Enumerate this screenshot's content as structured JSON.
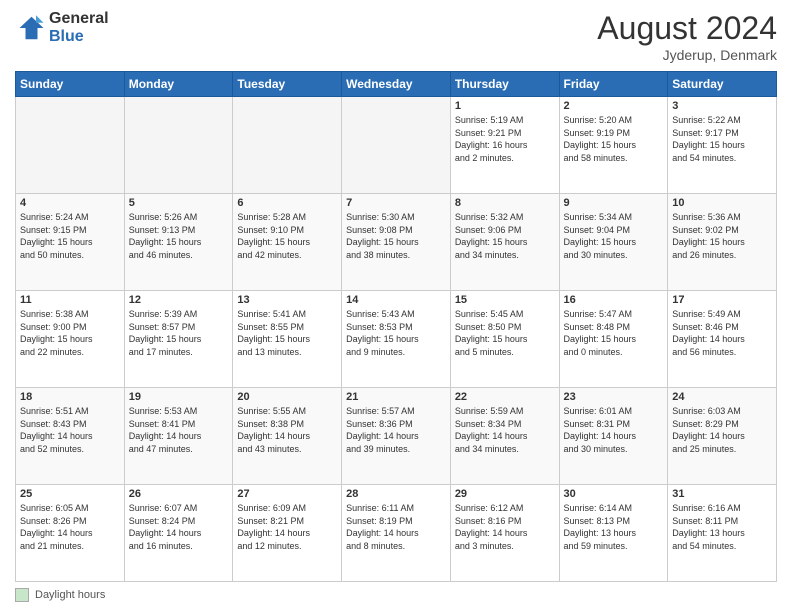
{
  "header": {
    "logo_line1": "General",
    "logo_line2": "Blue",
    "month_title": "August 2024",
    "location": "Jyderup, Denmark"
  },
  "footer": {
    "label": "Daylight hours"
  },
  "days_of_week": [
    "Sunday",
    "Monday",
    "Tuesday",
    "Wednesday",
    "Thursday",
    "Friday",
    "Saturday"
  ],
  "weeks": [
    [
      {
        "day": "",
        "info": ""
      },
      {
        "day": "",
        "info": ""
      },
      {
        "day": "",
        "info": ""
      },
      {
        "day": "",
        "info": ""
      },
      {
        "day": "1",
        "info": "Sunrise: 5:19 AM\nSunset: 9:21 PM\nDaylight: 16 hours\nand 2 minutes."
      },
      {
        "day": "2",
        "info": "Sunrise: 5:20 AM\nSunset: 9:19 PM\nDaylight: 15 hours\nand 58 minutes."
      },
      {
        "day": "3",
        "info": "Sunrise: 5:22 AM\nSunset: 9:17 PM\nDaylight: 15 hours\nand 54 minutes."
      }
    ],
    [
      {
        "day": "4",
        "info": "Sunrise: 5:24 AM\nSunset: 9:15 PM\nDaylight: 15 hours\nand 50 minutes."
      },
      {
        "day": "5",
        "info": "Sunrise: 5:26 AM\nSunset: 9:13 PM\nDaylight: 15 hours\nand 46 minutes."
      },
      {
        "day": "6",
        "info": "Sunrise: 5:28 AM\nSunset: 9:10 PM\nDaylight: 15 hours\nand 42 minutes."
      },
      {
        "day": "7",
        "info": "Sunrise: 5:30 AM\nSunset: 9:08 PM\nDaylight: 15 hours\nand 38 minutes."
      },
      {
        "day": "8",
        "info": "Sunrise: 5:32 AM\nSunset: 9:06 PM\nDaylight: 15 hours\nand 34 minutes."
      },
      {
        "day": "9",
        "info": "Sunrise: 5:34 AM\nSunset: 9:04 PM\nDaylight: 15 hours\nand 30 minutes."
      },
      {
        "day": "10",
        "info": "Sunrise: 5:36 AM\nSunset: 9:02 PM\nDaylight: 15 hours\nand 26 minutes."
      }
    ],
    [
      {
        "day": "11",
        "info": "Sunrise: 5:38 AM\nSunset: 9:00 PM\nDaylight: 15 hours\nand 22 minutes."
      },
      {
        "day": "12",
        "info": "Sunrise: 5:39 AM\nSunset: 8:57 PM\nDaylight: 15 hours\nand 17 minutes."
      },
      {
        "day": "13",
        "info": "Sunrise: 5:41 AM\nSunset: 8:55 PM\nDaylight: 15 hours\nand 13 minutes."
      },
      {
        "day": "14",
        "info": "Sunrise: 5:43 AM\nSunset: 8:53 PM\nDaylight: 15 hours\nand 9 minutes."
      },
      {
        "day": "15",
        "info": "Sunrise: 5:45 AM\nSunset: 8:50 PM\nDaylight: 15 hours\nand 5 minutes."
      },
      {
        "day": "16",
        "info": "Sunrise: 5:47 AM\nSunset: 8:48 PM\nDaylight: 15 hours\nand 0 minutes."
      },
      {
        "day": "17",
        "info": "Sunrise: 5:49 AM\nSunset: 8:46 PM\nDaylight: 14 hours\nand 56 minutes."
      }
    ],
    [
      {
        "day": "18",
        "info": "Sunrise: 5:51 AM\nSunset: 8:43 PM\nDaylight: 14 hours\nand 52 minutes."
      },
      {
        "day": "19",
        "info": "Sunrise: 5:53 AM\nSunset: 8:41 PM\nDaylight: 14 hours\nand 47 minutes."
      },
      {
        "day": "20",
        "info": "Sunrise: 5:55 AM\nSunset: 8:38 PM\nDaylight: 14 hours\nand 43 minutes."
      },
      {
        "day": "21",
        "info": "Sunrise: 5:57 AM\nSunset: 8:36 PM\nDaylight: 14 hours\nand 39 minutes."
      },
      {
        "day": "22",
        "info": "Sunrise: 5:59 AM\nSunset: 8:34 PM\nDaylight: 14 hours\nand 34 minutes."
      },
      {
        "day": "23",
        "info": "Sunrise: 6:01 AM\nSunset: 8:31 PM\nDaylight: 14 hours\nand 30 minutes."
      },
      {
        "day": "24",
        "info": "Sunrise: 6:03 AM\nSunset: 8:29 PM\nDaylight: 14 hours\nand 25 minutes."
      }
    ],
    [
      {
        "day": "25",
        "info": "Sunrise: 6:05 AM\nSunset: 8:26 PM\nDaylight: 14 hours\nand 21 minutes."
      },
      {
        "day": "26",
        "info": "Sunrise: 6:07 AM\nSunset: 8:24 PM\nDaylight: 14 hours\nand 16 minutes."
      },
      {
        "day": "27",
        "info": "Sunrise: 6:09 AM\nSunset: 8:21 PM\nDaylight: 14 hours\nand 12 minutes."
      },
      {
        "day": "28",
        "info": "Sunrise: 6:11 AM\nSunset: 8:19 PM\nDaylight: 14 hours\nand 8 minutes."
      },
      {
        "day": "29",
        "info": "Sunrise: 6:12 AM\nSunset: 8:16 PM\nDaylight: 14 hours\nand 3 minutes."
      },
      {
        "day": "30",
        "info": "Sunrise: 6:14 AM\nSunset: 8:13 PM\nDaylight: 13 hours\nand 59 minutes."
      },
      {
        "day": "31",
        "info": "Sunrise: 6:16 AM\nSunset: 8:11 PM\nDaylight: 13 hours\nand 54 minutes."
      }
    ]
  ]
}
